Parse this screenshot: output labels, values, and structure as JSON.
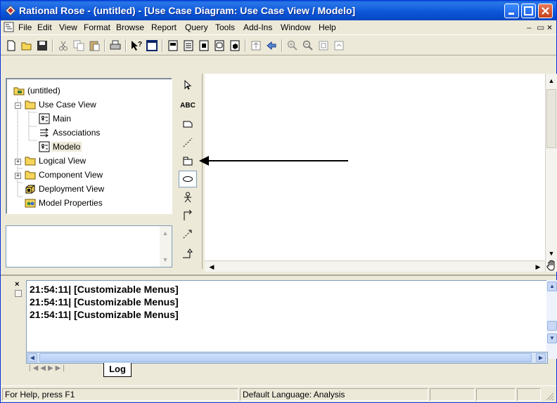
{
  "window": {
    "title": "Rational Rose - (untitled) - [Use Case Diagram: Use Case View / Modelo]",
    "controls": [
      "minimize",
      "maximize",
      "close"
    ]
  },
  "menubar": {
    "items": [
      "File",
      "Edit",
      "View",
      "Format",
      "Browse",
      "Report",
      "Query",
      "Tools",
      "Add-Ins",
      "Window",
      "Help"
    ]
  },
  "toolbar": {
    "buttons": [
      "new-icon",
      "open-icon",
      "save-icon",
      "cut-icon",
      "copy-icon",
      "paste-icon",
      "print-icon",
      "context-help-icon",
      "view-doc-icon",
      "browse-class-icon",
      "browse-interaction-icon",
      "browse-component-icon",
      "browse-state-icon",
      "browse-deployment-icon",
      "browse-parent-icon",
      "browse-previous-icon",
      "zoom-in-icon",
      "zoom-out-icon",
      "fit-window-icon",
      "undo-fit-icon"
    ]
  },
  "tree": {
    "root": "(untitled)",
    "items": [
      {
        "label": "Use Case View",
        "icon": "folder-icon"
      },
      {
        "label": "Main",
        "icon": "use-case-diagram-icon"
      },
      {
        "label": "Associations",
        "icon": "associations-icon"
      },
      {
        "label": "Modelo",
        "icon": "use-case-diagram-icon"
      },
      {
        "label": "Logical View",
        "icon": "folder-icon"
      },
      {
        "label": "Component View",
        "icon": "folder-icon"
      },
      {
        "label": "Deployment View",
        "icon": "deployment-icon"
      },
      {
        "label": "Model Properties",
        "icon": "model-properties-icon"
      }
    ]
  },
  "toolbox": {
    "tools": [
      "selection-arrow-icon",
      "text-box-icon",
      "note-icon",
      "anchor-note-icon",
      "package-icon",
      "use-case-icon",
      "actor-icon",
      "unidirectional-association-icon",
      "dependency-icon",
      "generalization-icon"
    ],
    "text_tool_label": "ABC"
  },
  "log": {
    "lines": [
      "21:54:11|  [Customizable Menus]",
      "21:54:11|  [Customizable Menus]",
      "21:54:11|  [Customizable Menus]"
    ],
    "tab": "Log"
  },
  "statusbar": {
    "help": "For Help, press F1",
    "language": "Default Language: Analysis"
  }
}
